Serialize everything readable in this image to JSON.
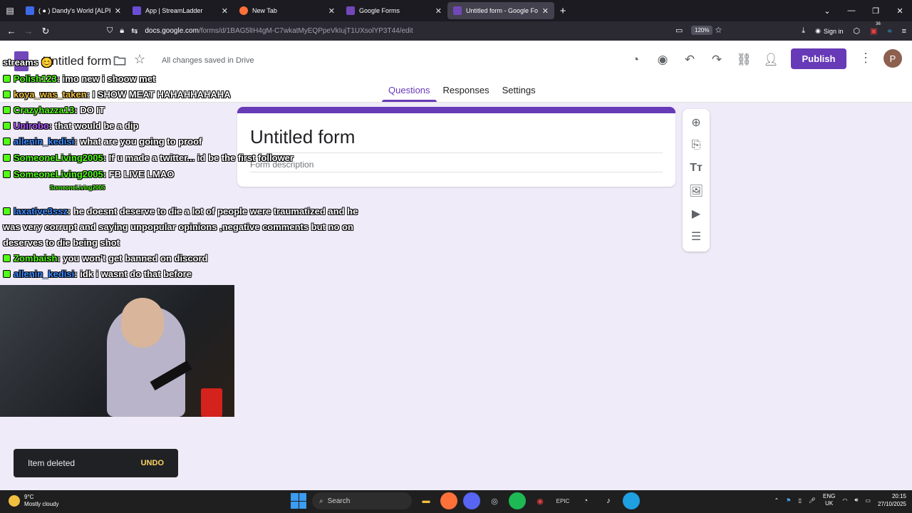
{
  "browser": {
    "tabs": [
      {
        "label": "( ● ) Dandy's World [ALPHA",
        "color": "#3d6ae8"
      },
      {
        "label": "App | StreamLadder",
        "color": "#6a4cd6"
      },
      {
        "label": "New Tab",
        "color": "#ff7139"
      },
      {
        "label": "Google Forms",
        "color": "#7248b9"
      },
      {
        "label": "Untitled form - Google Forms",
        "color": "#7248b9",
        "active": true
      }
    ],
    "url_domain": "docs.google.com",
    "url_path": "/forms/d/1BAG5lIH4gM-C7wkatMyEQPpeVkIujT1UXsolYP3T44/edit",
    "zoom": "120%",
    "signin_label": "Sign in",
    "extension_badge": "36"
  },
  "forms": {
    "doc_title": "Untitled form",
    "saved_status": "All changes saved in Drive",
    "publish_label": "Publish",
    "avatar_letter": "P",
    "tabs": [
      "Questions",
      "Responses",
      "Settings"
    ],
    "form_title": "Untitled form",
    "form_description": "Form description",
    "snackbar_message": "Item deleted",
    "snackbar_action": "UNDO",
    "accent": "#673ab7"
  },
  "chat": [
    {
      "user": "",
      "text": "streams 😊"
    },
    {
      "user": "Polish123",
      "text": ": imo new i shoow met"
    },
    {
      "user": "koya_was_taken",
      "text": ": I SHOW MEAT HAHAHHAHAHA"
    },
    {
      "user": "Crazyhazza13",
      "text": ": DO IT"
    },
    {
      "user": "Unirobo",
      "text": ": that would be a dip"
    },
    {
      "user": "allenin_kedisi",
      "text": ": what are you going to proof"
    },
    {
      "user": "SomeoneLiving2005",
      "text": ": If u made a twitter... id be the first follower"
    },
    {
      "user": "SomeoneLiving2005",
      "text": ": FB LIVE LMAO"
    },
    {
      "user": "",
      "text": "SomeoneLiving2005"
    },
    {
      "user": "laxative3ssz",
      "text": ": he doesnt deserve to die a lot of people were traumatized and he"
    },
    {
      "user": "",
      "text": "was very corrupt and saying unpopular opinions ,negative comments but no on"
    },
    {
      "user": "",
      "text": "deserves to die being shot"
    },
    {
      "user": "Zombaish",
      "text": ": you won't get banned on discord"
    },
    {
      "user": "allenin_kedisi",
      "text": ": idk i wasnt do that before"
    }
  ],
  "taskbar": {
    "temperature": "9°C",
    "weather": "Mostly cloudy",
    "search_label": "Search",
    "lang": "ENG",
    "region": "UK",
    "time": "20:15",
    "date": "27/10/2025"
  }
}
